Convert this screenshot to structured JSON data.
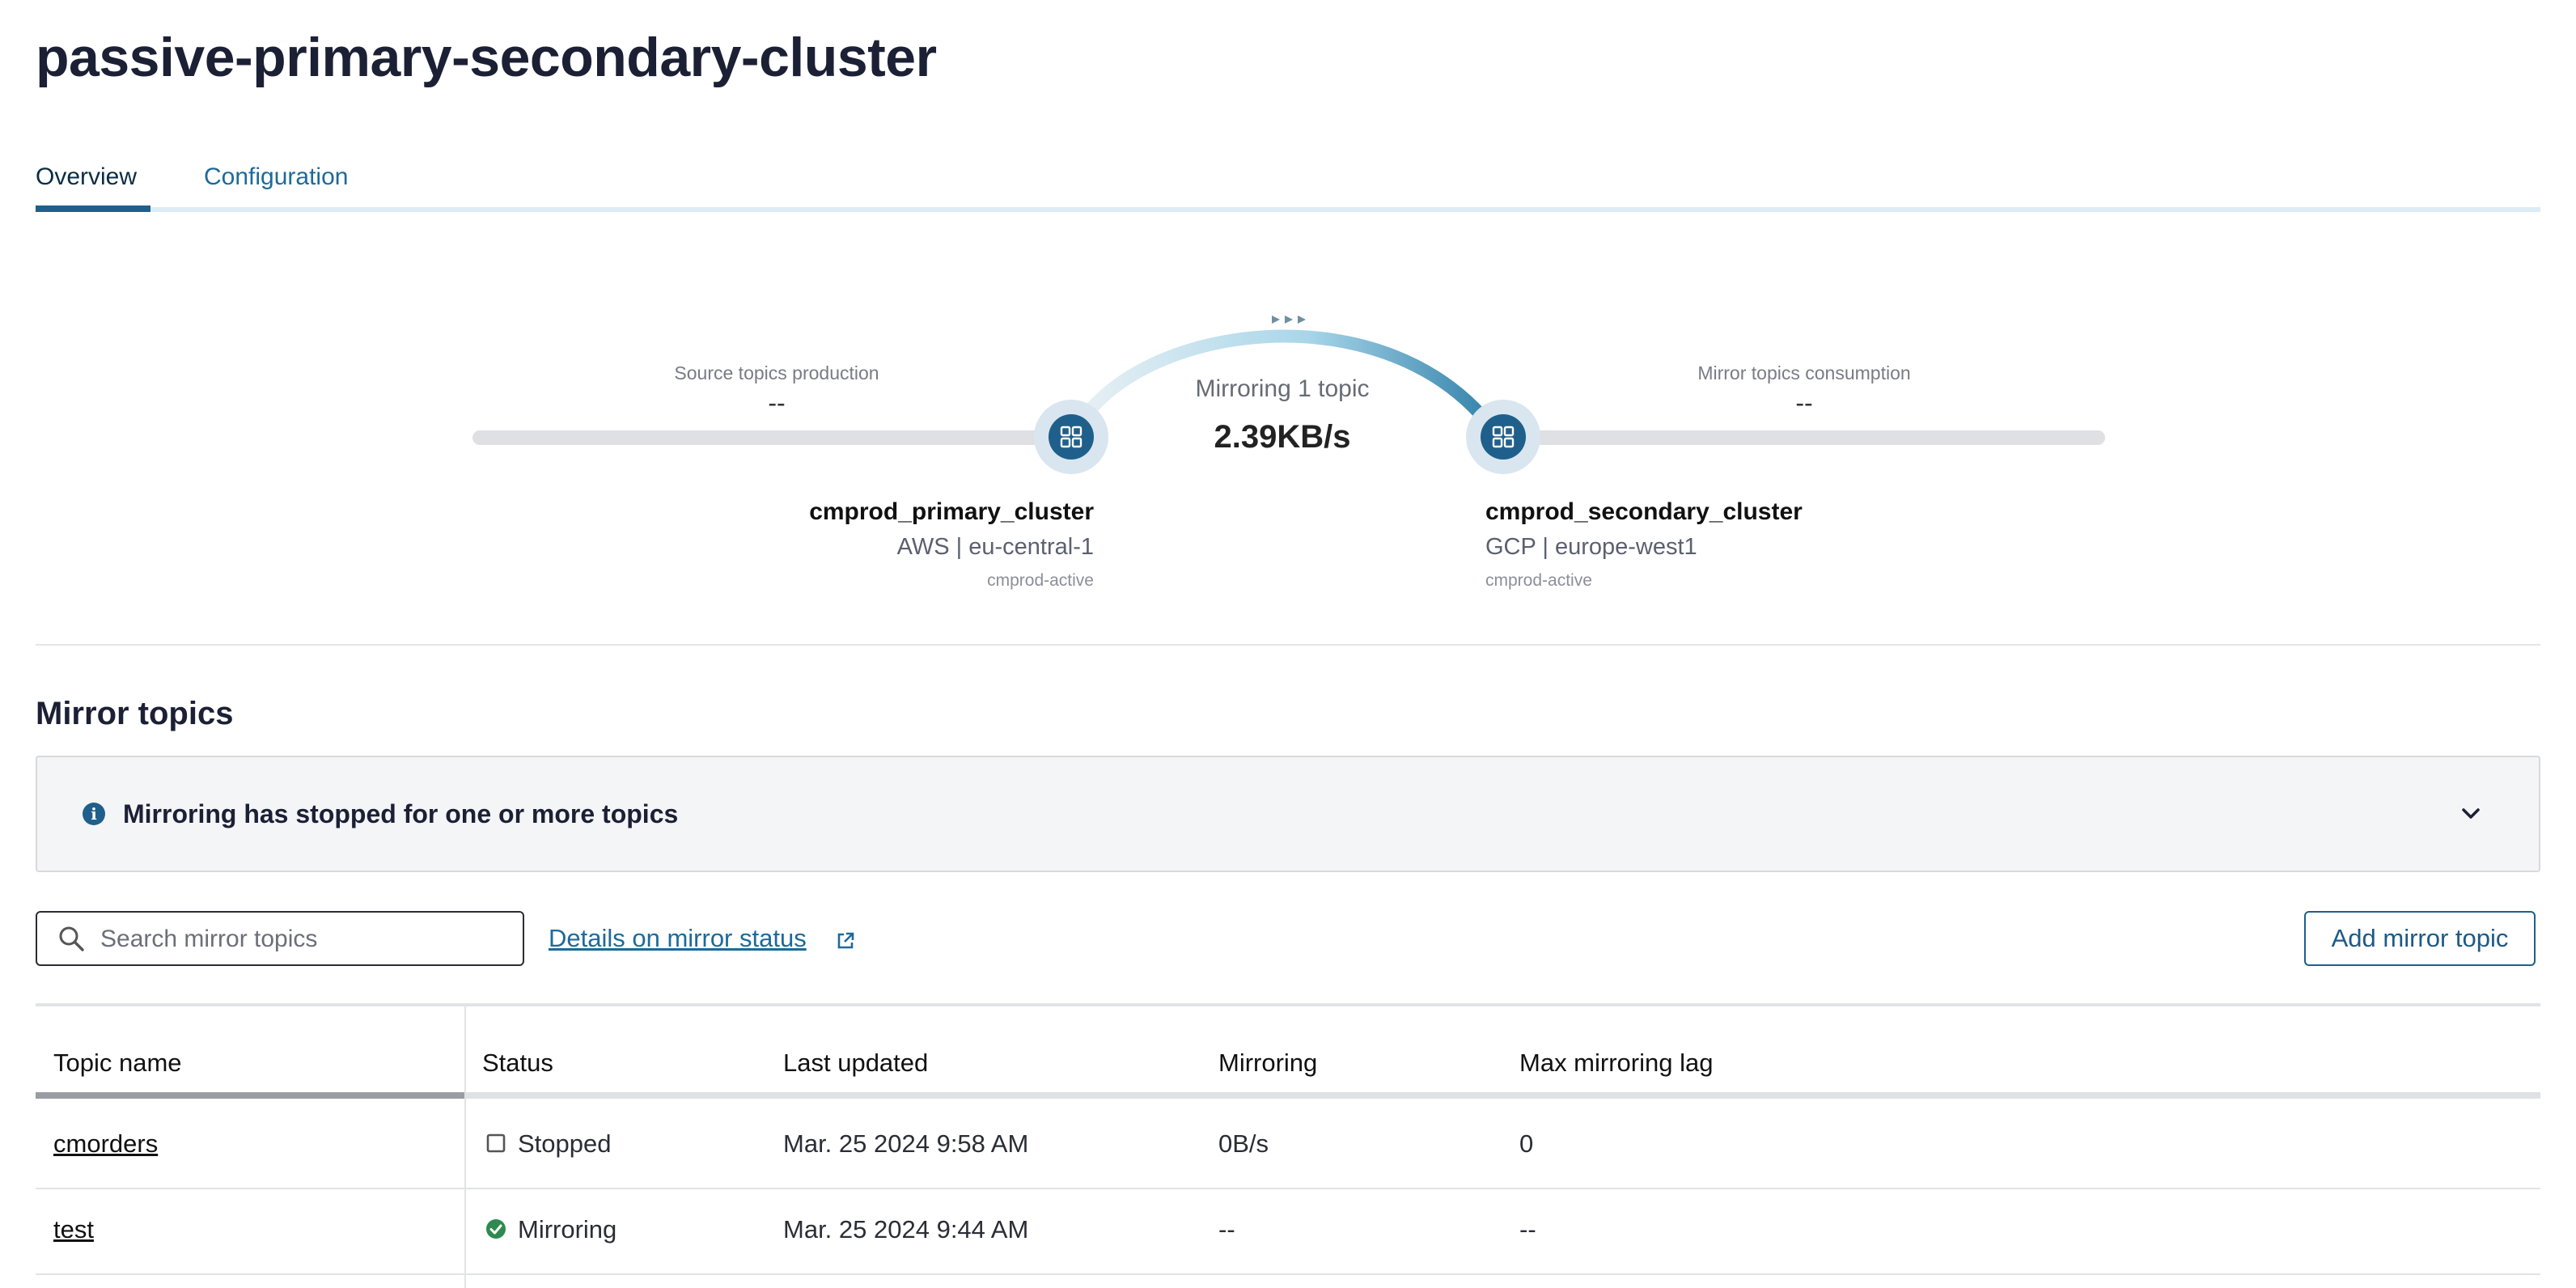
{
  "page": {
    "title": "passive-primary-secondary-cluster"
  },
  "tabs": [
    {
      "label": "Overview",
      "active": true
    },
    {
      "label": "Configuration",
      "active": false
    }
  ],
  "topology": {
    "source_metric": {
      "label": "Source topics production",
      "value": "--"
    },
    "mirror_metric": {
      "label": "Mirror topics consumption",
      "value": "--"
    },
    "link": {
      "count_text": "Mirroring 1 topic",
      "rate": "2.39KB/s"
    },
    "source_cluster": {
      "name": "cmprod_primary_cluster",
      "region": "AWS | eu-central-1",
      "env": "cmprod-active",
      "icon": "cluster-icon"
    },
    "destination_cluster": {
      "name": "cmprod_secondary_cluster",
      "region": "GCP | europe-west1",
      "env": "cmprod-active",
      "icon": "cluster-icon"
    }
  },
  "mirror_topics": {
    "title": "Mirror topics",
    "alert": {
      "text": "Mirroring has stopped for one or more topics",
      "icon": "info-icon",
      "expand_icon": "chevron-down-icon"
    },
    "search": {
      "placeholder": "Search mirror topics"
    },
    "details_link": "Details on mirror status",
    "add_button": "Add mirror topic",
    "table": {
      "columns": [
        "Topic name",
        "Status",
        "Last updated",
        "Mirroring",
        "Max mirroring lag"
      ],
      "rows": [
        {
          "topic": "cmorders",
          "status": "Stopped",
          "status_icon": "stopped-square-icon",
          "last_updated": "Mar. 25 2024 9:58 AM",
          "mirroring": "0B/s",
          "max_lag": "0"
        },
        {
          "topic": "test",
          "status": "Mirroring",
          "status_icon": "check-circle-icon",
          "last_updated": "Mar. 25 2024 9:44 AM",
          "mirroring": "--",
          "max_lag": "--"
        }
      ]
    }
  },
  "colors": {
    "accent": "#1f5f8b",
    "link": "#1d6a9a",
    "success": "#2e8a4f"
  }
}
